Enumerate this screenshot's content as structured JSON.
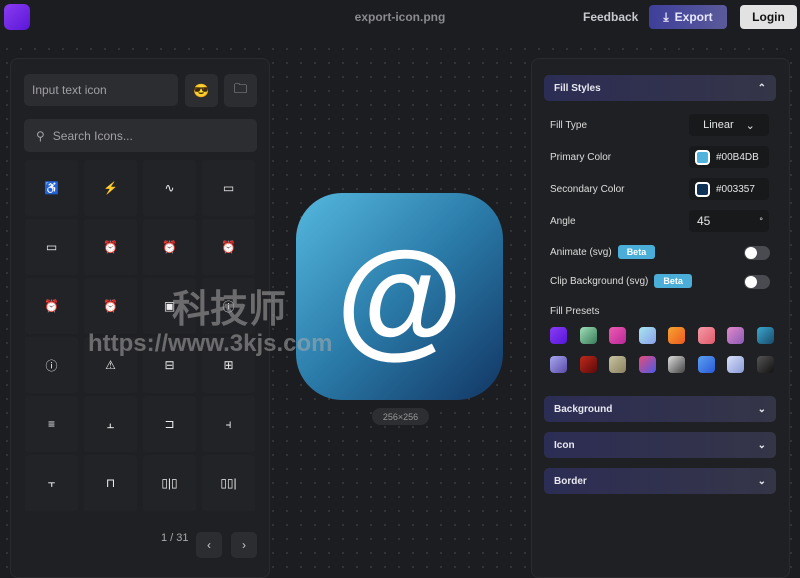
{
  "header": {
    "filename": "export-icon.png",
    "feedback": "Feedback",
    "export": "Export",
    "login": "Login"
  },
  "left": {
    "text_placeholder": "Input text icon",
    "emoji": "😎",
    "search_placeholder": "Search Icons...",
    "icons": [
      "accessible",
      "activity-square",
      "activity",
      "air-conditioning",
      "airplay",
      "alarm-check",
      "alarm-clock-off",
      "alarm-clock",
      "alarm-minus",
      "alarm-plus",
      "album",
      "alert-circle",
      "alert-octagon",
      "alert-triangle",
      "align-center-horizontal",
      "align-center-vertical",
      "align-center",
      "align-end-horizontal",
      "align-end-vertical",
      "align-horizontal-distribute-center",
      "align-horizontal-distribute-end",
      "align-horizontal-distribute-start",
      "align-horizontal-justify-center",
      "align-horizontal-justify-end"
    ],
    "glyphs": [
      "♿",
      "⚡",
      "∿",
      "▭",
      "▭",
      "⏰",
      "⏰",
      "⏰",
      "⏰",
      "⏰",
      "▣",
      "ⓘ",
      "ⓘ",
      "⚠",
      "⊟",
      "⊞",
      "≡",
      "⫠",
      "⊐",
      "⫞",
      "⫟",
      "⊓",
      "▯|▯",
      "▯▯|"
    ],
    "page": "1 / 31"
  },
  "canvas": {
    "glyph": "@",
    "size": "256×256"
  },
  "right": {
    "fill_styles": "Fill Styles",
    "fill_type_label": "Fill Type",
    "fill_type": "Linear",
    "primary_label": "Primary Color",
    "primary": "#00B4DB",
    "primary_swatch": "#4fb3dc",
    "secondary_label": "Secondary Color",
    "secondary": "#003357",
    "secondary_swatch": "#0f3257",
    "angle_label": "Angle",
    "angle": "45",
    "angle_unit": "°",
    "animate_label": "Animate (svg)",
    "animate_on": false,
    "clip_label": "Clip Background (svg)",
    "clip_on": false,
    "beta": "Beta",
    "presets_label": "Fill Presets",
    "presets": [
      "linear-gradient(135deg,#8b3cf5,#5516d8)",
      "linear-gradient(135deg,#9ee0b8,#3a7a5a)",
      "linear-gradient(135deg,#ef5bb0,#b8289a)",
      "linear-gradient(135deg,#a8e6f0,#8aa0e8)",
      "linear-gradient(135deg,#f7a430,#ec5a20)",
      "linear-gradient(135deg,#f49aa8,#e05a6a)",
      "linear-gradient(135deg,#e28ac8,#8a5ab8)",
      "linear-gradient(135deg,#3aa8d0,#1a4a6a)",
      "linear-gradient(135deg,#a8a8f0,#5a4aa8)",
      "linear-gradient(135deg,#c0281a,#5a0a0a)",
      "linear-gradient(135deg,#c8c4a0,#8a8060)",
      "linear-gradient(135deg,#e84a7a,#4a5ae8)",
      "linear-gradient(135deg,#ddd,#444)",
      "linear-gradient(135deg,#5aa0f0,#2a5ad8)",
      "linear-gradient(135deg,#d8e0f8,#8a9ad8)",
      "linear-gradient(135deg,#555,#111)"
    ],
    "sections": [
      "Background",
      "Icon",
      "Border"
    ]
  },
  "watermark": {
    "cn": "科技师",
    "url": "https://www.3kjs.com"
  }
}
